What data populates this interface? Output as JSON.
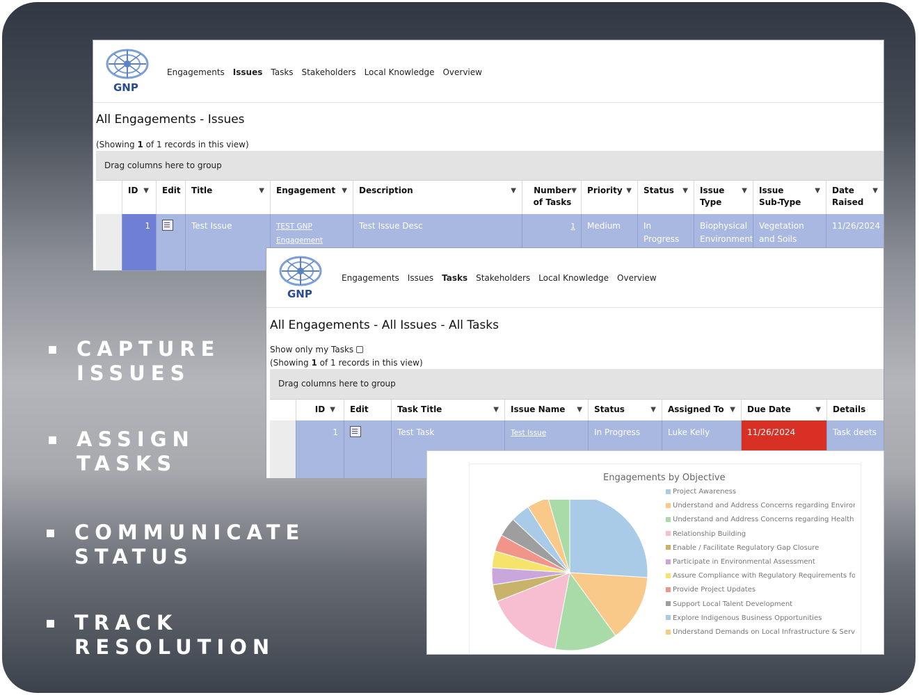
{
  "bullets": [
    {
      "line1": "CAPTURE",
      "line2": "ISSUES"
    },
    {
      "line1": "ASSIGN",
      "line2": "TASKS"
    },
    {
      "line1": "COMMUNICATE",
      "line2": "STATUS"
    },
    {
      "line1": "TRACK",
      "line2": "RESOLUTION"
    }
  ],
  "issues_panel": {
    "logo_text": "GNP",
    "nav": [
      "Engagements",
      "Issues",
      "Tasks",
      "Stakeholders",
      "Local Knowledge",
      "Overview"
    ],
    "active_nav": "Issues",
    "title": "All Engagements - Issues",
    "showing_pre": "(Showing ",
    "showing_count": "1",
    "showing_post": " of 1 records in this view)",
    "group_bar": "Drag columns here to group",
    "columns": [
      "ID",
      "Edit",
      "Title",
      "Engagement",
      "Description",
      "Number of Tasks",
      "Priority",
      "Status",
      "Issue Type",
      "Issue Sub-Type",
      "Date Raised"
    ],
    "row": {
      "id": "1",
      "title": "Test Issue",
      "engagement": "TEST GNP Engagement",
      "description": "Test Issue Desc",
      "number_of_tasks": "1",
      "priority": "Medium",
      "status": "In Progress",
      "issue_type": "Biophysical Environment",
      "issue_sub_type": "Vegetation and Soils",
      "date_raised": "11/26/2024"
    }
  },
  "tasks_panel": {
    "logo_text": "GNP",
    "nav": [
      "Engagements",
      "Issues",
      "Tasks",
      "Stakeholders",
      "Local Knowledge",
      "Overview"
    ],
    "active_nav": "Tasks",
    "title": "All Engagements - All Issues - All Tasks",
    "show_only_label": "Show only my Tasks",
    "showing_pre": "(Showing ",
    "showing_count": "1",
    "showing_post": " of 1 records in this view)",
    "group_bar": "Drag columns here to group",
    "columns": [
      "ID",
      "Edit",
      "Task Title",
      "Issue Name",
      "Status",
      "Assigned To",
      "Due Date",
      "Details"
    ],
    "row": {
      "id": "1",
      "task_title": "Test Task",
      "issue_name": "Test Issue",
      "status": "In Progress",
      "assigned_to": "Luke Kelly",
      "due_date": "11/26/2024",
      "details": "Task deets"
    },
    "due_date_color": "#d93025"
  },
  "chart_data": {
    "type": "pie",
    "title": "Engagements by Objective",
    "legend_position": "right",
    "series": [
      {
        "name": "Project Awareness",
        "value": 26,
        "color": "#a9cbe8"
      },
      {
        "name": "Understand and Address Concerns regarding Enviror",
        "value": 14,
        "color": "#f9c98a"
      },
      {
        "name": "Understand and Address Concerns regarding Health",
        "value": 13,
        "color": "#a8dba8"
      },
      {
        "name": "Relationship Building",
        "value": 16,
        "color": "#f7bdd0"
      },
      {
        "name": "Enable / Facilitate Regulatory Gap Closure",
        "value": 3.5,
        "color": "#c9b26a"
      },
      {
        "name": "Participate in Environmental Assessment",
        "value": 3.5,
        "color": "#c9a6dc"
      },
      {
        "name": "Assure Compliance with Regulatory Requirements for",
        "value": 3.5,
        "color": "#f5e36b"
      },
      {
        "name": "Provide Project Updates",
        "value": 3.5,
        "color": "#f1948a"
      },
      {
        "name": "Support Local Talent Development",
        "value": 4,
        "color": "#9e9e9e"
      },
      {
        "name": "Explore Indigenous Business Opportunities",
        "value": 4,
        "color": "#a9cbe8"
      },
      {
        "name": "Understand Demands on Local Infrastructure & Servi",
        "value": 4.5,
        "color": "#f9c98a"
      },
      {
        "name": "",
        "value": 4.5,
        "color": "#a8dba8"
      }
    ]
  }
}
